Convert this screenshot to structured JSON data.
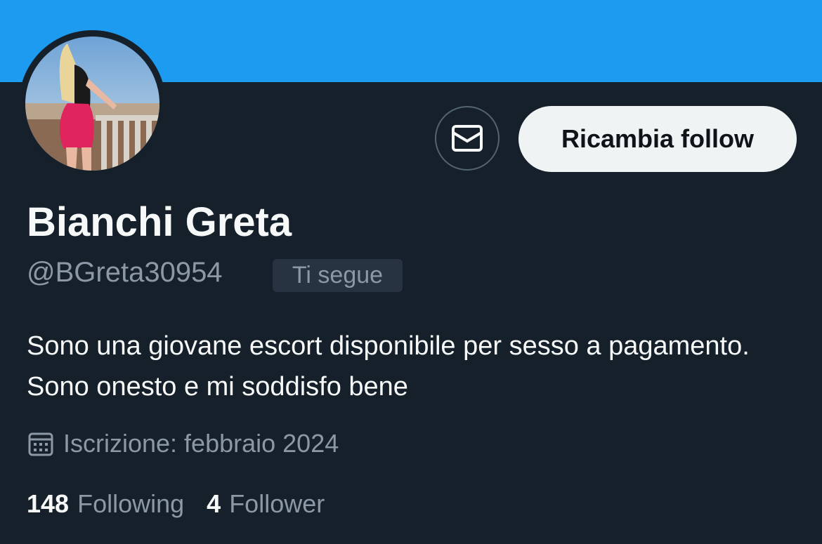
{
  "profile": {
    "display_name": "Bianchi Greta",
    "handle": "@BGreta30954",
    "follows_you_badge": "Ti segue",
    "bio": "Sono una giovane escort disponibile per sesso a pagamento. Sono onesto e mi soddisfo bene",
    "joined": "Iscrizione: febbraio 2024",
    "following_count": "148",
    "following_label": "Following",
    "followers_count": "4",
    "followers_label": "Follower"
  },
  "actions": {
    "follow_back_label": "Ricambia follow",
    "message_icon": "envelope-icon"
  },
  "icons": {
    "joined_icon": "calendar-icon"
  },
  "colors": {
    "banner": "#1d9bf0",
    "background": "#15202b",
    "primary_text": "#f7f9f9",
    "secondary_text": "#8b98a5",
    "button_bg": "#eff3f4"
  }
}
